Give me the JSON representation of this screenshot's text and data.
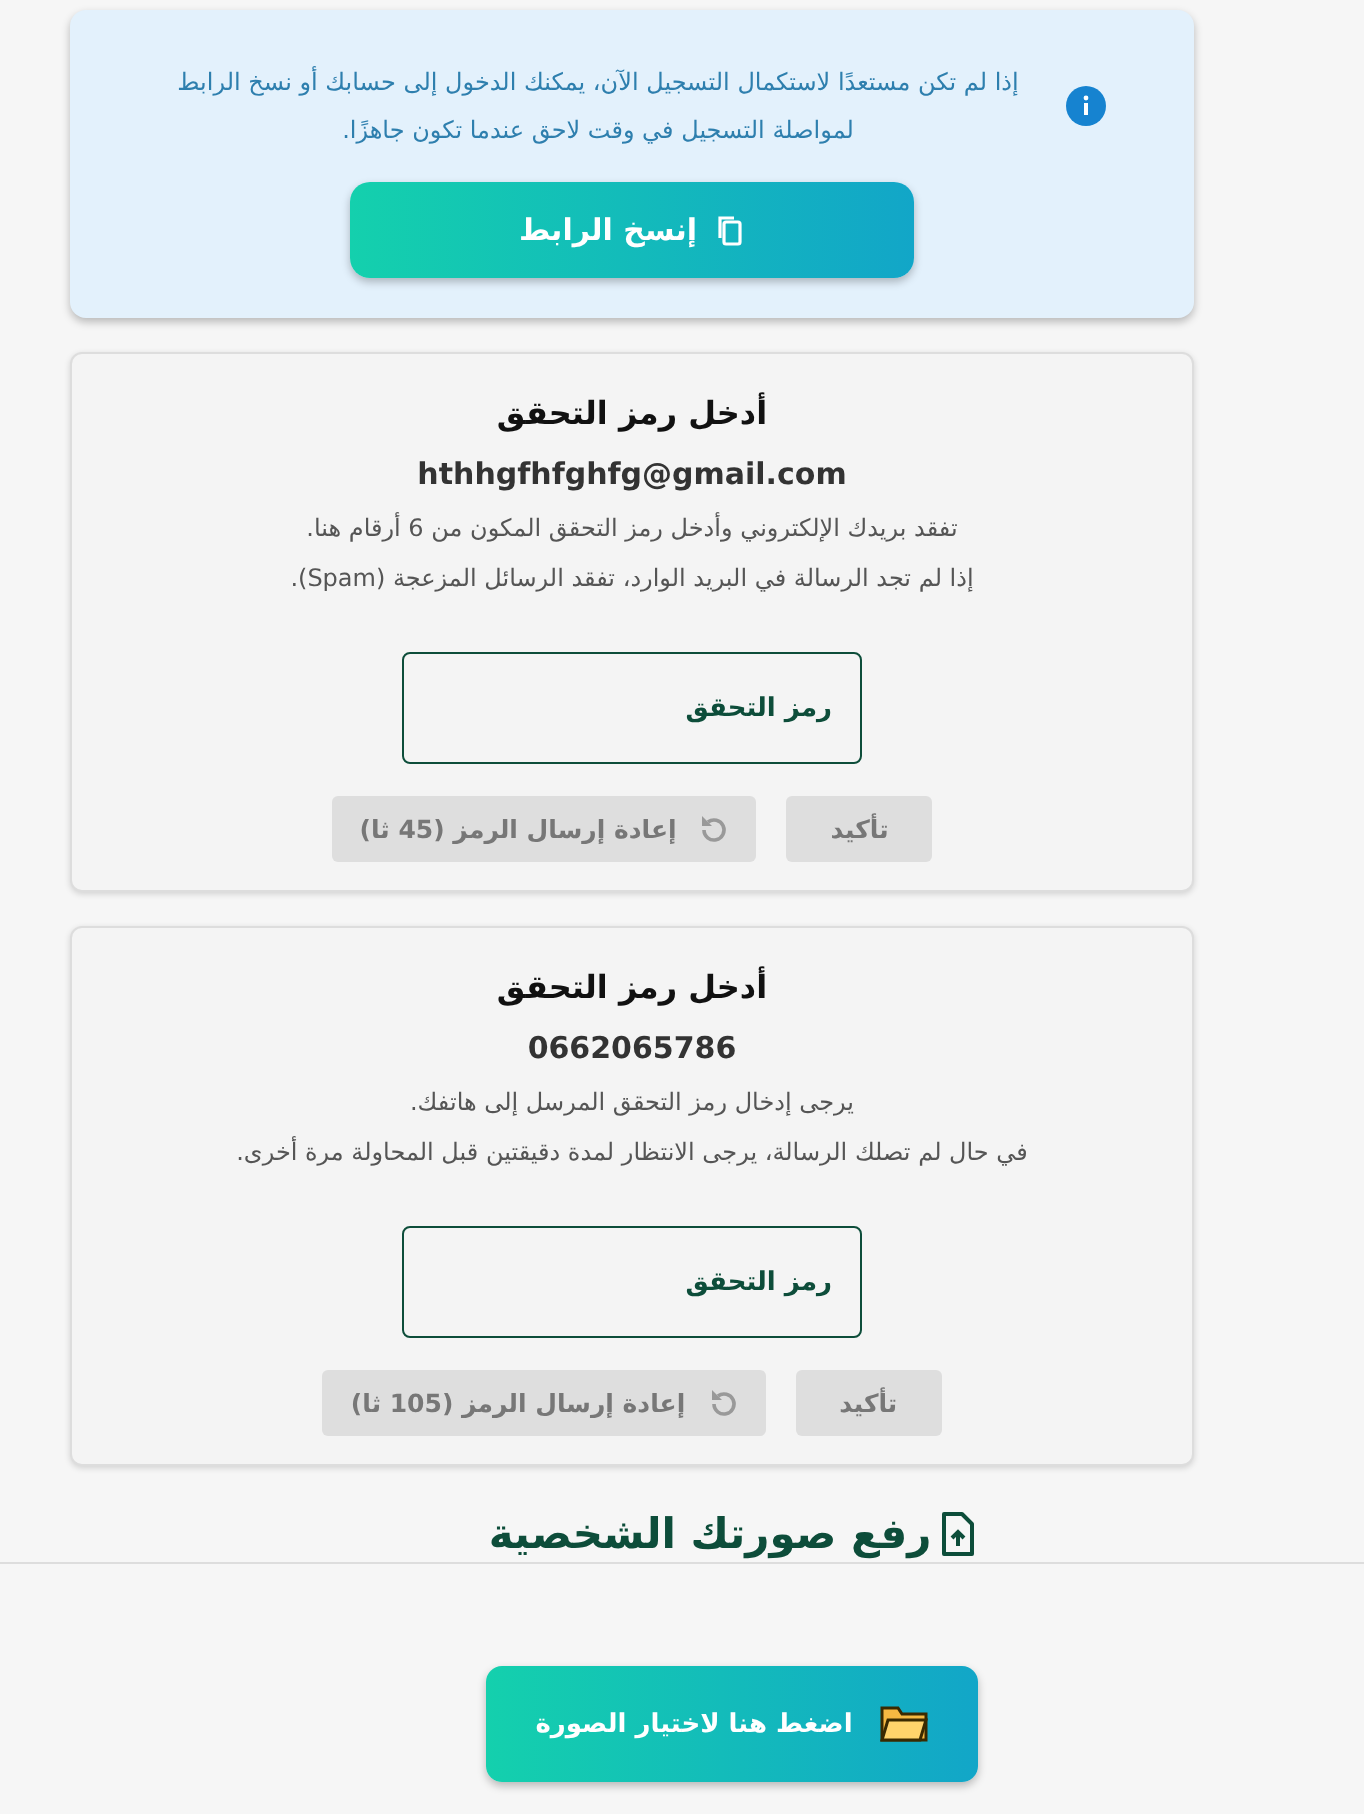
{
  "notice": {
    "text": "إذا لم تكن مستعدًا لاستكمال التسجيل الآن، يمكنك الدخول إلى حسابك أو نسخ الرابط لمواصلة التسجيل في وقت لاحق عندما تكون جاهزًا.",
    "button": "إنسخ الرابط"
  },
  "verification_cards": [
    {
      "title": "أدخل رمز التحقق",
      "target": "hthhgfhfghfg@gmail.com",
      "lines": [
        "تفقد بريدك الإلكتروني وأدخل رمز التحقق المكون من 6 أرقام هنا.",
        "إذا لم تجد الرسالة في البريد الوارد، تفقد الرسائل المزعجة (Spam)."
      ],
      "placeholder": "رمز التحقق",
      "confirm": {
        "label": "تأكيد",
        "disabled": true
      },
      "resend": {
        "label": "إعادة إرسال الرمز (45 ثا)",
        "disabled": true
      }
    },
    {
      "title": "أدخل رمز التحقق",
      "target": "0662065786",
      "lines": [
        "يرجى إدخال رمز التحقق المرسل إلى هاتفك.",
        "في حال لم تصلك الرسالة، يرجى الانتظار لمدة دقيقتين قبل المحاولة مرة أخرى."
      ],
      "placeholder": "رمز التحقق",
      "confirm": {
        "label": "تأكيد",
        "disabled": true
      },
      "resend": {
        "label": "إعادة إرسال الرمز (105 ثا)",
        "disabled": true
      }
    }
  ],
  "upload": {
    "heading": "رفع صورتك الشخصية",
    "button": "اضغط هنا لاختيار الصورة"
  }
}
